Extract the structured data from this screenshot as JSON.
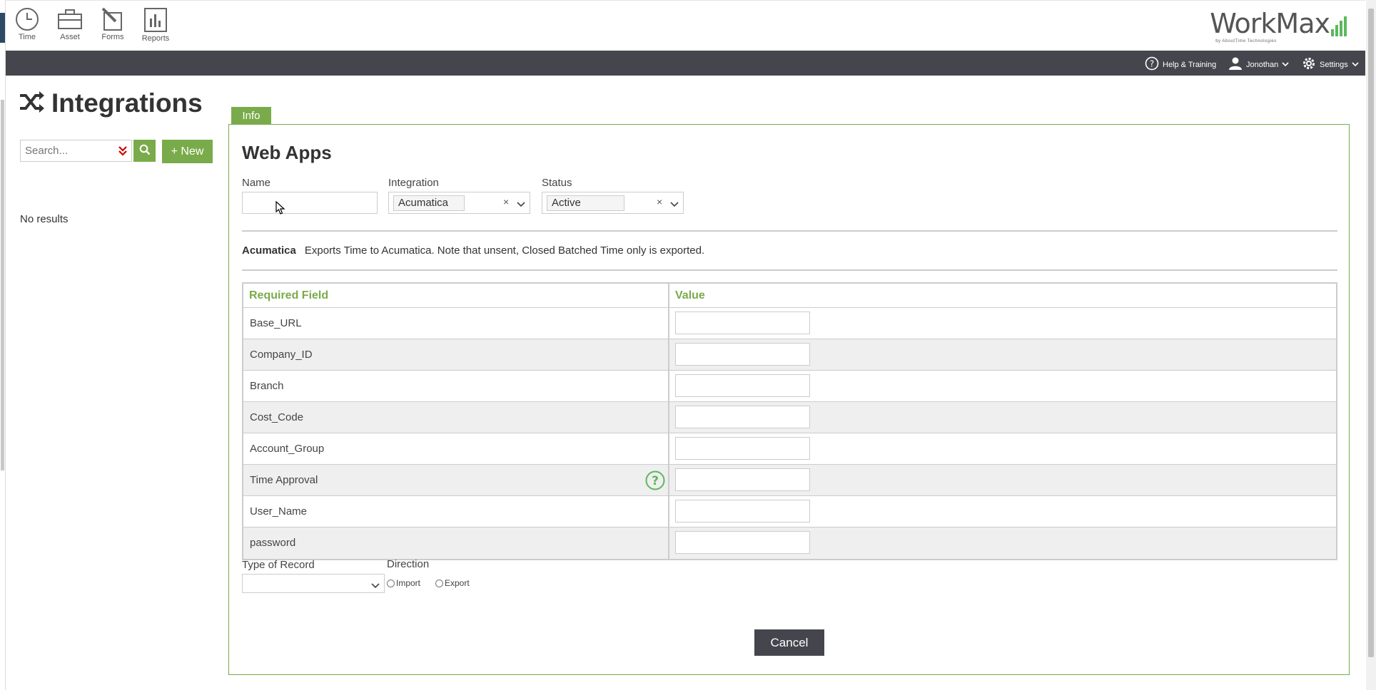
{
  "nav": {
    "items": [
      {
        "label": "Time",
        "icon": "clock-icon"
      },
      {
        "label": "Asset",
        "icon": "briefcase-icon"
      },
      {
        "label": "Forms",
        "icon": "form-edit-icon"
      },
      {
        "label": "Reports",
        "icon": "bar-chart-icon"
      }
    ]
  },
  "logo": {
    "word": "WorkMax",
    "sub": "by AboutTime Technologies"
  },
  "header": {
    "help_label": "Help & Training",
    "user_label": "Jonothan",
    "settings_label": "Settings"
  },
  "sidebar": {
    "title": "Integrations",
    "search_placeholder": "Search...",
    "new_label": "+ New",
    "no_results": "No results"
  },
  "tabs": [
    {
      "label": "Info"
    }
  ],
  "form": {
    "title": "Web Apps",
    "name_label": "Name",
    "name_value": "",
    "integration_label": "Integration",
    "integration_value": "Acumatica",
    "status_label": "Status",
    "status_value": "Active",
    "description_name": "Acumatica",
    "description_text": "Exports Time to Acumatica. Note that unsent, Closed Batched Time only is exported.",
    "table_headers": [
      "Required Field",
      "Value"
    ],
    "fields": [
      {
        "name": "Base_URL",
        "value": ""
      },
      {
        "name": "Company_ID",
        "value": ""
      },
      {
        "name": "Branch",
        "value": ""
      },
      {
        "name": "Cost_Code",
        "value": ""
      },
      {
        "name": "Account_Group",
        "value": ""
      },
      {
        "name": "Time Approval",
        "value": ""
      },
      {
        "name": "User_Name",
        "value": ""
      },
      {
        "name": "password",
        "value": ""
      }
    ],
    "type_of_record_label": "Type of Record",
    "type_of_record_value": "",
    "direction_label": "Direction",
    "direction_options": [
      "Import",
      "Export"
    ],
    "cancel_label": "Cancel"
  },
  "colors": {
    "accent": "#7aab4a",
    "header_dark": "#45454d",
    "help_icon": "#5cb85c"
  }
}
